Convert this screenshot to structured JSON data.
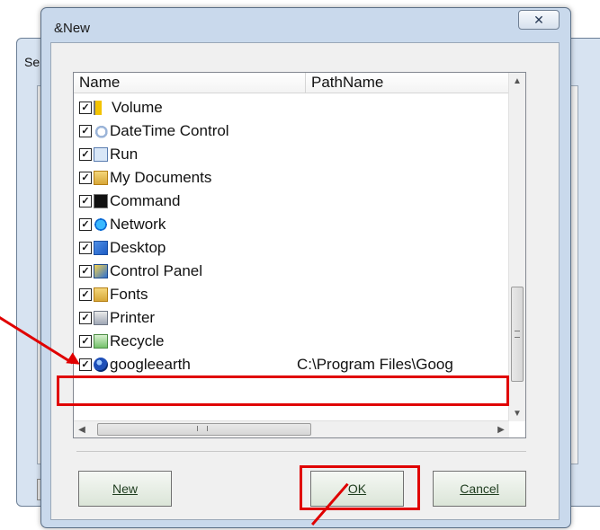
{
  "background_window": {
    "title_fragment": "Se"
  },
  "dialog": {
    "title": "&New",
    "close_glyph": "✕"
  },
  "list": {
    "columns": [
      "Name",
      "PathName"
    ],
    "rows": [
      {
        "name": "Volume",
        "path": "",
        "icon": "volume-icon",
        "checked": true
      },
      {
        "name": "DateTime Control",
        "path": "",
        "icon": "datetime-icon",
        "checked": true
      },
      {
        "name": "Run",
        "path": "",
        "icon": "run-icon",
        "checked": true
      },
      {
        "name": "My Documents",
        "path": "",
        "icon": "my-documents-icon",
        "checked": true
      },
      {
        "name": "Command",
        "path": "",
        "icon": "command-icon",
        "checked": true
      },
      {
        "name": "Network",
        "path": "",
        "icon": "network-icon",
        "checked": true
      },
      {
        "name": "Desktop",
        "path": "",
        "icon": "desktop-icon",
        "checked": true
      },
      {
        "name": "Control Panel",
        "path": "",
        "icon": "control-panel-icon",
        "checked": true
      },
      {
        "name": "Fonts",
        "path": "",
        "icon": "fonts-icon",
        "checked": true
      },
      {
        "name": "Printer",
        "path": "",
        "icon": "printer-icon",
        "checked": true
      },
      {
        "name": "Recycle",
        "path": "",
        "icon": "recycle-icon",
        "checked": true
      },
      {
        "name": "googleearth",
        "path": "C:\\Program Files\\Goog",
        "icon": "google-earth-icon",
        "checked": true
      }
    ],
    "scrollbar": {
      "up": "▲",
      "down": "▼",
      "left": "◀",
      "right": "▶",
      "grip_h": "III",
      "grip_v": "≡"
    }
  },
  "buttons": {
    "new": "New",
    "ok": "OK",
    "cancel": "Cancel"
  },
  "colors": {
    "annotation_red": "#e00000",
    "button_text": "#1f3d1f"
  }
}
